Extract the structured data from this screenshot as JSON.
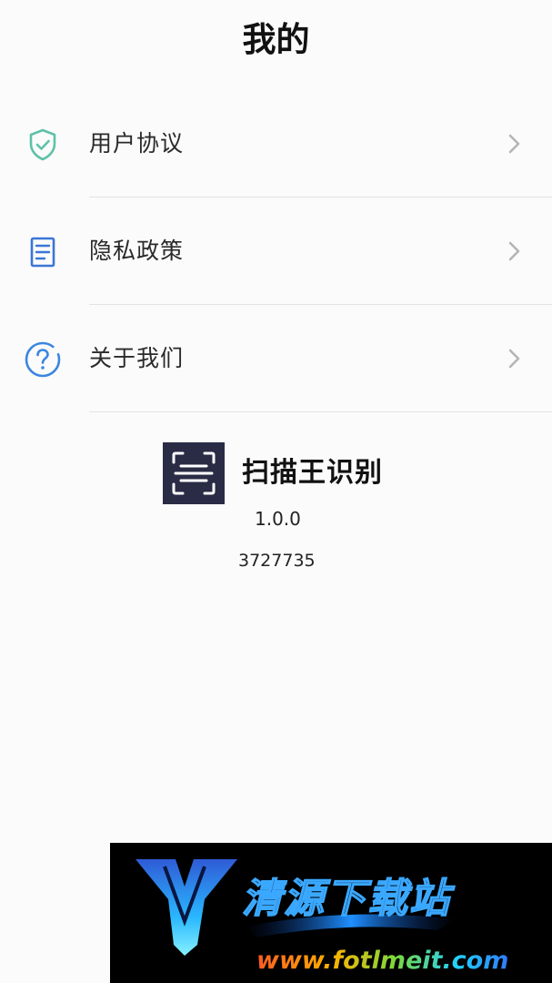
{
  "header": {
    "title": "我的"
  },
  "menu": {
    "items": [
      {
        "label": "用户协议",
        "icon": "shield-check-icon"
      },
      {
        "label": "隐私政策",
        "icon": "document-icon"
      },
      {
        "label": "关于我们",
        "icon": "question-circle-icon"
      }
    ]
  },
  "app_info": {
    "name": "扫描王识别",
    "version": "1.0.0",
    "build": "3727735",
    "logo_icon": "scan-frame-icon"
  },
  "watermark": {
    "text": "清源下载站",
    "url": "www.fotlmeit.com"
  },
  "colors": {
    "background": "#fbfbfb",
    "shield_icon": "#5ec2a8",
    "document_icon": "#3b76d6",
    "question_icon": "#3b86e0",
    "chevron": "#b5b5b5",
    "divider": "#e3e3e3",
    "logo_background": "#2a2b45"
  }
}
